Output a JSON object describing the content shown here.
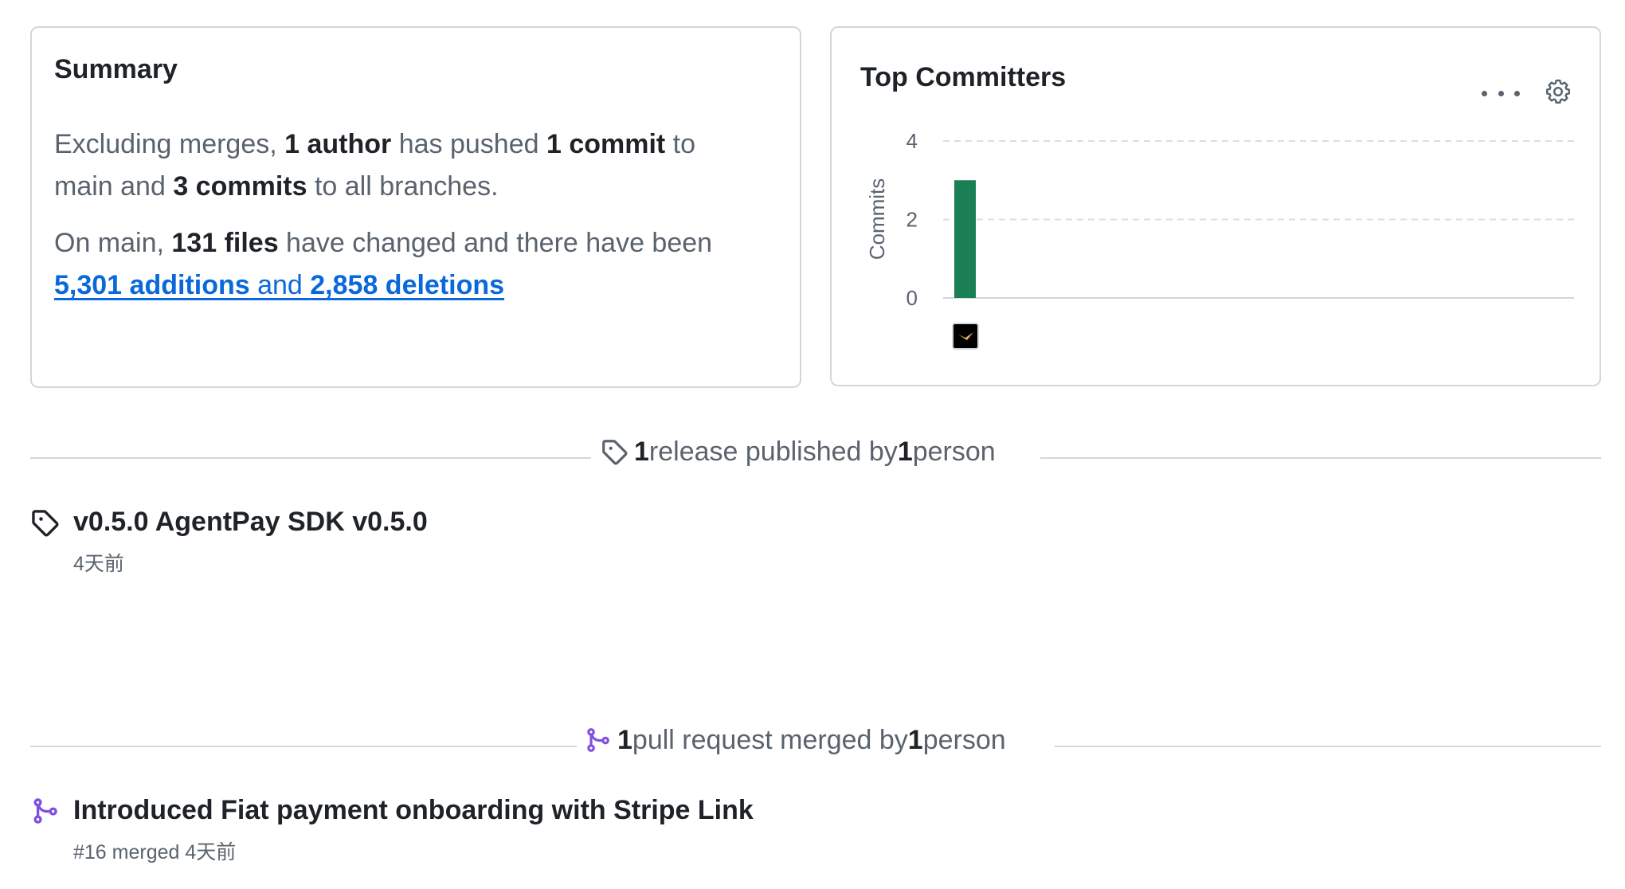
{
  "summary": {
    "title": "Summary",
    "p1": {
      "t1": "Excluding merges, ",
      "authors": "1 author",
      "t2": " has pushed ",
      "commits_main": "1 commit",
      "t3": " to",
      "t4": "main and ",
      "commits_all": "3 commits",
      "t5": " to all branches."
    },
    "p2": {
      "t1": "On main, ",
      "files": "131 files",
      "t2": " have changed and there have been",
      "additions": "5,301 additions",
      "and": " and ",
      "deletions": "2,858 deletions"
    }
  },
  "top_committers": {
    "title": "Top Committers",
    "more_icon": "kebab-horizontal-icon",
    "settings_icon": "gear-icon"
  },
  "chart_data": {
    "type": "bar",
    "title": "Top Committers",
    "ylabel": "Commits",
    "xlabel": "",
    "categories": [
      "committer-1"
    ],
    "values": [
      3
    ],
    "ylim": [
      0,
      4
    ],
    "yticks": [
      "0",
      "2",
      "4"
    ],
    "grid": true,
    "bar_color": "#1a7f52",
    "x_tick_type": "avatar"
  },
  "releases": {
    "heading": {
      "count": "1",
      "mid": " release published by ",
      "people": "1",
      "end": " person"
    },
    "icon": "tag-icon",
    "items": [
      {
        "title": "v0.5.0 AgentPay SDK v0.5.0",
        "time": "4天前"
      }
    ]
  },
  "pull_requests": {
    "heading": {
      "count": "1",
      "mid": " pull request merged by ",
      "people": "1",
      "end": " person"
    },
    "icon": "git-merge-icon",
    "items": [
      {
        "title": "Introduced Fiat payment onboarding with Stripe Link",
        "meta": "#16 merged 4天前"
      }
    ]
  },
  "colors": {
    "text": "#1f2328",
    "muted": "#59636e",
    "link": "#0969da",
    "border": "#d0d7de",
    "bar": "#1a7f52",
    "merged": "#8250df"
  }
}
